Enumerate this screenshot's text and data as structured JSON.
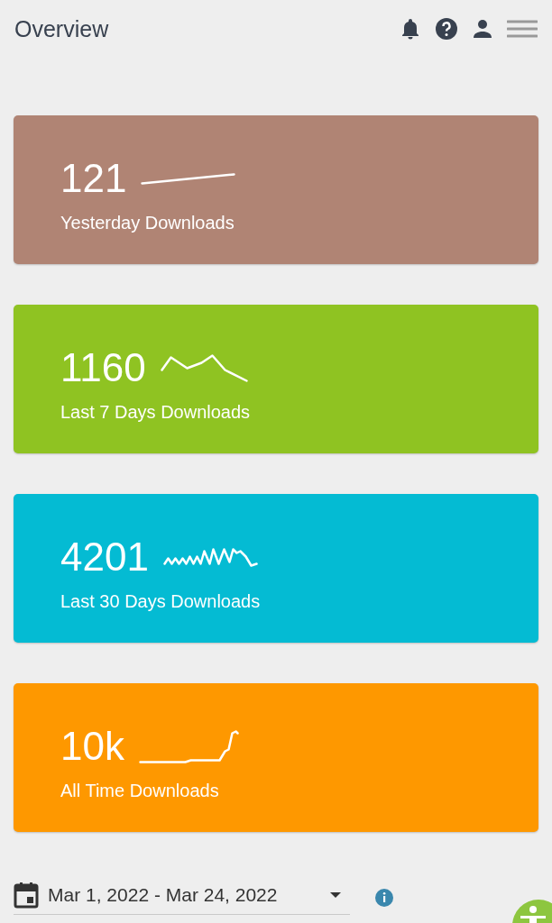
{
  "header": {
    "title": "Overview"
  },
  "cards": [
    {
      "value": "121",
      "label": "Yesterday Downloads",
      "color": "#b08474"
    },
    {
      "value": "1160",
      "label": "Last 7 Days Downloads",
      "color": "#8fc322"
    },
    {
      "value": "4201",
      "label": "Last 30 Days Downloads",
      "color": "#04bbd3"
    },
    {
      "value": "10k",
      "label": "All Time Downloads",
      "color": "#fe9800"
    }
  ],
  "date_range": {
    "value": "Mar 1, 2022 - Mar 24, 2022"
  }
}
